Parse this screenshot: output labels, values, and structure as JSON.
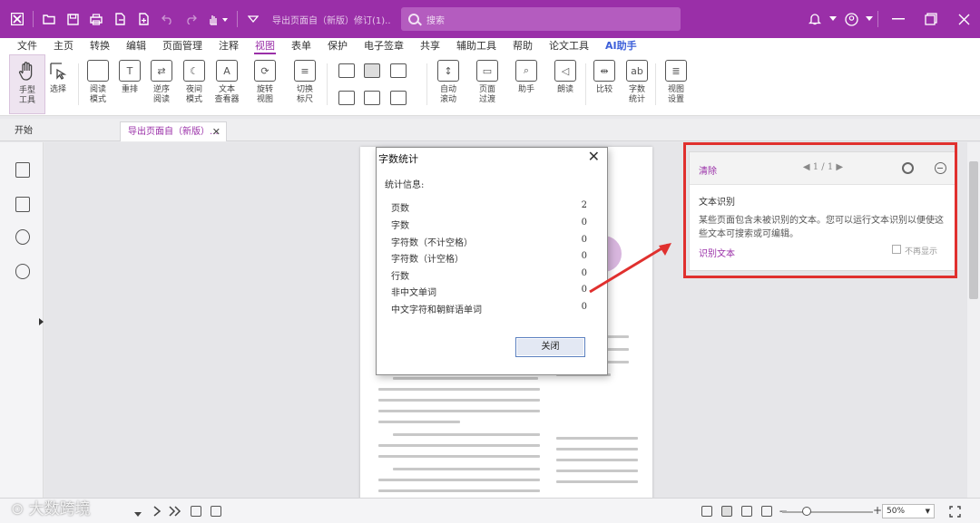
{
  "titlebar": {
    "doc_title": "导出页面自（新版）修订(1)...",
    "search_placeholder": "搜索"
  },
  "menu": [
    "文件",
    "主页",
    "转换",
    "编辑",
    "页面管理",
    "注释",
    "视图",
    "表单",
    "保护",
    "电子签章",
    "共享",
    "辅助工具",
    "帮助",
    "论文工具",
    "AI助手"
  ],
  "menu_active_index": 6,
  "ribbon": {
    "hand_tool": "手型\n工具",
    "select": "选择",
    "reading_mode": "阅读\n模式",
    "reflow": "重排",
    "reverse_read": "逆序\n阅读",
    "night_mode": "夜间\n模式",
    "text_viewer": "文本\n查看器",
    "rotate_view": "旋转\n视图",
    "switch_ruler": "切换\n标尺",
    "auto_scroll": "自动\n滚动",
    "page_transition": "页面\n过渡",
    "assistant": "助手",
    "read_aloud": "朗读",
    "compare": "比较",
    "word_count": "字数\n统计",
    "view_settings": "视图\n设置"
  },
  "tabs": {
    "home": "开始",
    "doc": "导出页面自（新版）...",
    "close": "✕"
  },
  "dialog": {
    "title": "字数统计",
    "close": "✕",
    "subtitle": "统计信息:",
    "rows": [
      {
        "label": "页数",
        "value": "2"
      },
      {
        "label": "字数",
        "value": "0"
      },
      {
        "label": "字符数（不计空格）",
        "value": "0"
      },
      {
        "label": "字符数（计空格）",
        "value": "0"
      },
      {
        "label": "行数",
        "value": "0"
      },
      {
        "label": "非中文单词",
        "value": "0"
      },
      {
        "label": "中文字符和朝鲜语单词",
        "value": "0"
      }
    ],
    "close_button": "关闭"
  },
  "ocr_panel": {
    "clear": "清除",
    "pager": "◀  1 / 1  ▶",
    "title": "文本识别",
    "description": "某些页面包含未被识别的文本。您可以运行文本识别以便使这些文本可搜索或可编辑。",
    "action": "识别文本",
    "dont_show": "不再显示"
  },
  "statusbar": {
    "zoom": "50%"
  },
  "watermark": "大数跨境",
  "colors": {
    "brand": "#9a2fa8",
    "highlight_box": "#e0302e",
    "ai_label": "#3c5fd9"
  }
}
